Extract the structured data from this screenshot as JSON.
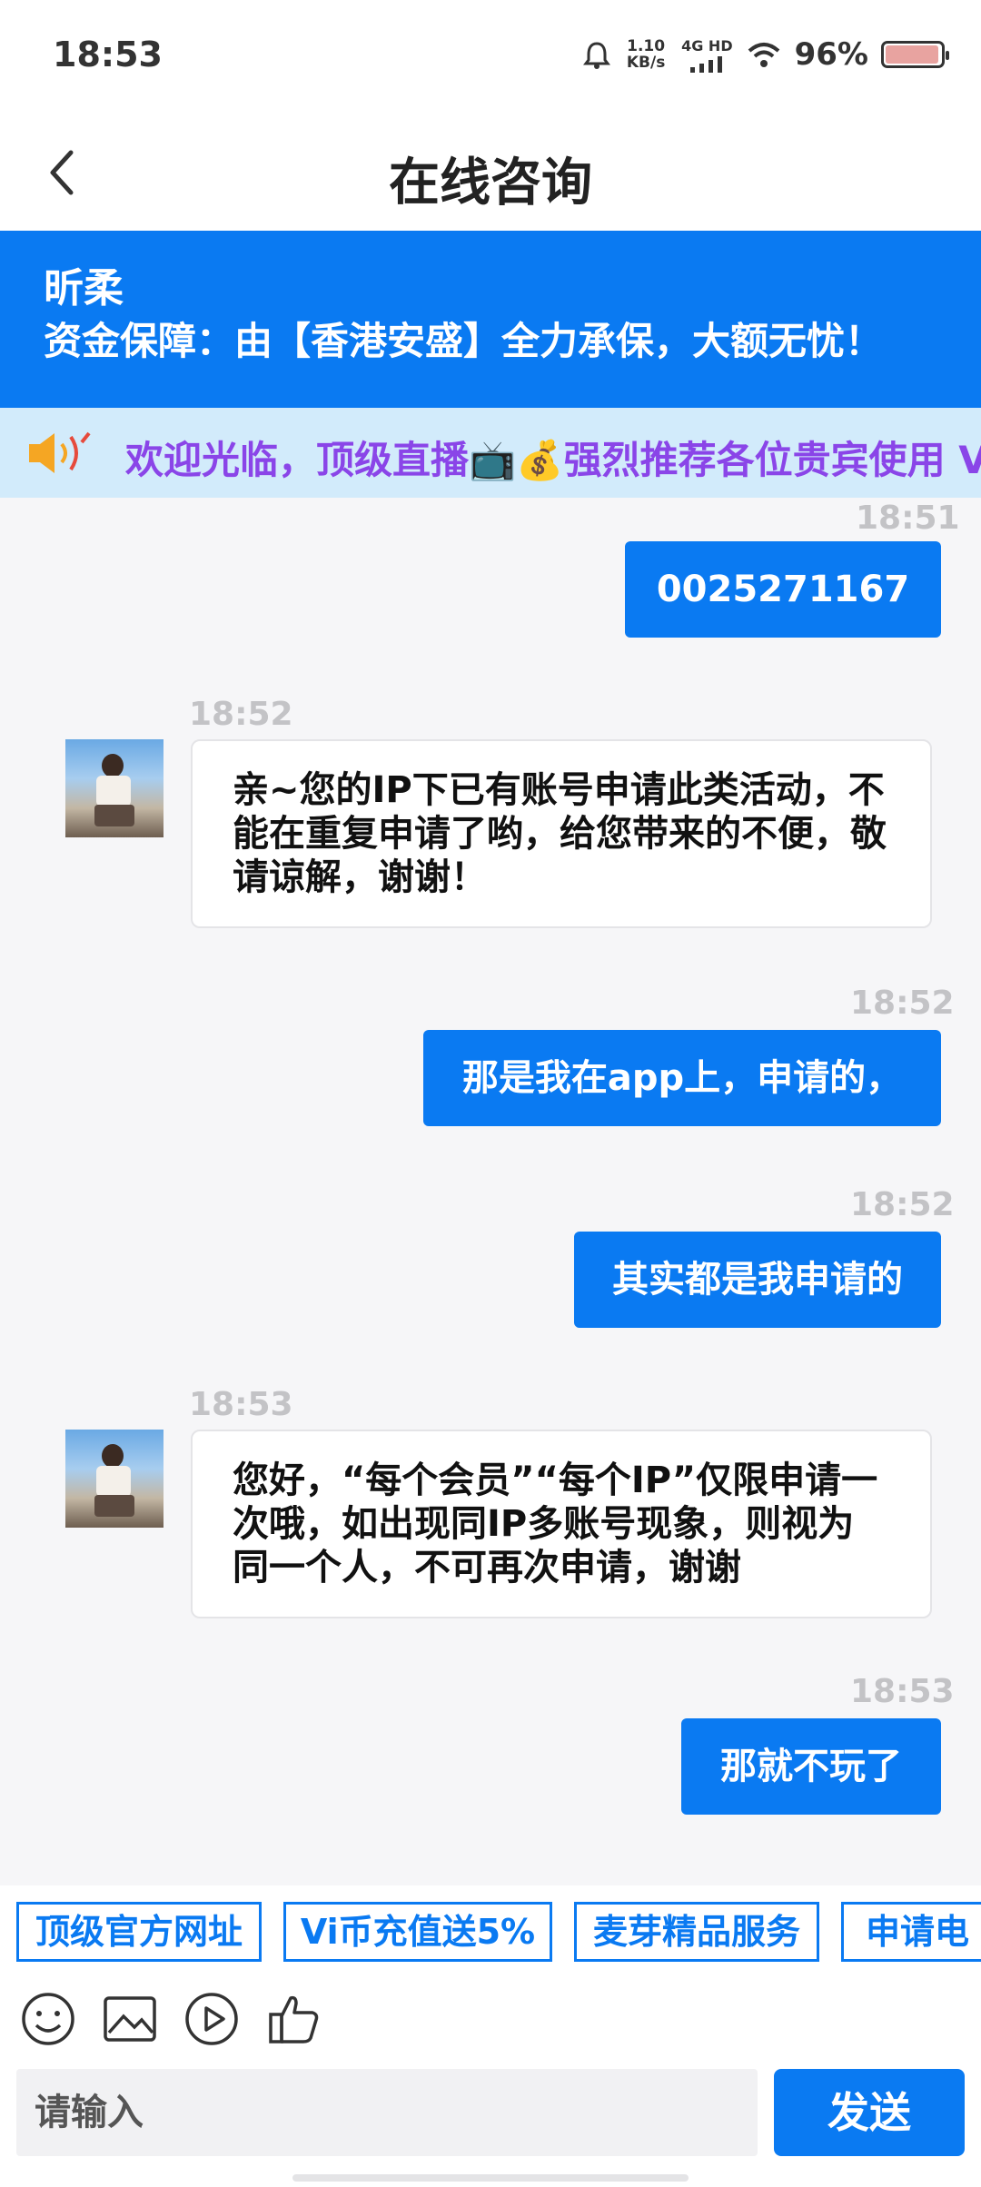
{
  "status_bar": {
    "time": "18:53",
    "net_speed": "1.10 KB/s",
    "network": "4G HD",
    "battery_percent": "96%",
    "battery_level": 0.96
  },
  "header": {
    "title": "在线咨询"
  },
  "banner": {
    "name": "昕柔",
    "notice": "资金保障：由【香港安盛】全力承保，大额无忧！"
  },
  "marquee": {
    "text": "欢迎光临，顶级直播📺💰强烈推荐各位贵宾使用 Vi币"
  },
  "messages": [
    {
      "direction": "out",
      "time": "18:51",
      "text": "0025271167"
    },
    {
      "direction": "in",
      "time": "18:52",
      "text": "亲~您的IP下已有账号申请此类活动，不能在重复申请了哟，给您带来的不便，敬请谅解，谢谢！"
    },
    {
      "direction": "out",
      "time": "18:52",
      "text": "那是我在app上，申请的，"
    },
    {
      "direction": "out",
      "time": "18:52",
      "text": "其实都是我申请的"
    },
    {
      "direction": "in",
      "time": "18:53",
      "text": "您好，“每个会员”“每个IP”仅限申请一次哦，如出现同IP多账号现象，则视为同一个人，不可再次申请，谢谢"
    },
    {
      "direction": "out",
      "time": "18:53",
      "text": "那就不玩了"
    }
  ],
  "quick_replies": [
    "顶级官方网址",
    "Vi币充值送5%",
    "麦芽精品服务",
    "申请电"
  ],
  "toolbar": {
    "icons": [
      "emoji-icon",
      "image-icon",
      "video-icon",
      "thumbs-up-icon"
    ]
  },
  "input": {
    "placeholder": "请输入",
    "value": "",
    "send_label": "发送"
  },
  "colors": {
    "accent": "#0a7af2",
    "marquee_bg": "#d2ebfb",
    "marquee_text": "#8a45e8"
  }
}
